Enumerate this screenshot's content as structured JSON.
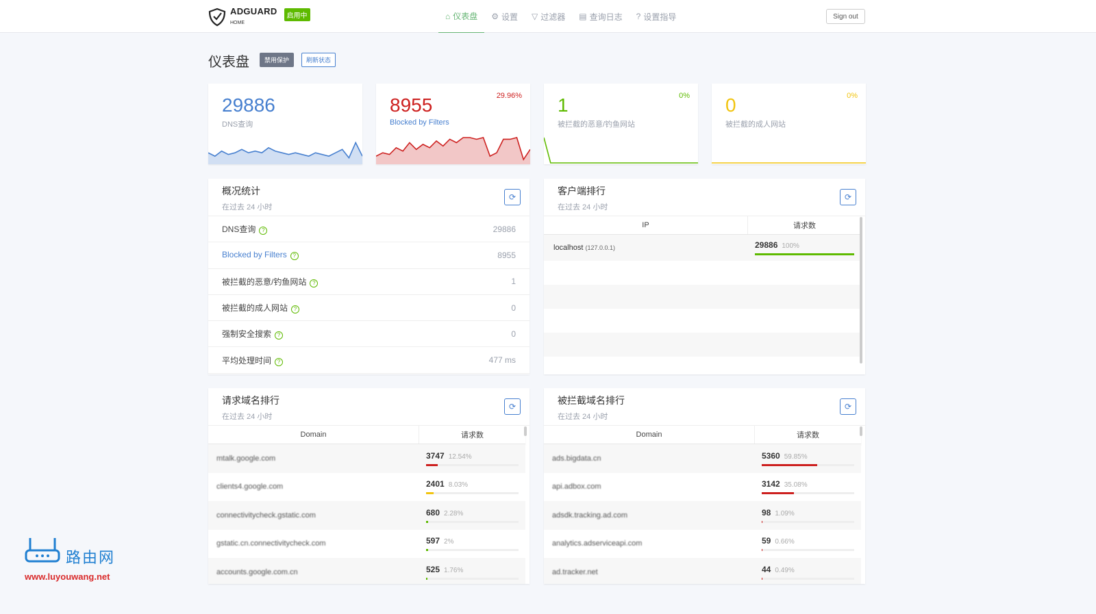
{
  "header": {
    "brand": "ADGUARD",
    "brand_sub": "HOME",
    "status_badge": "启用中",
    "sign_out": "Sign out",
    "nav": [
      {
        "label": "仪表盘",
        "icon": "home-icon",
        "active": true
      },
      {
        "label": "设置",
        "icon": "gear-icon"
      },
      {
        "label": "过滤器",
        "icon": "filter-icon"
      },
      {
        "label": "查询日志",
        "icon": "document-icon"
      },
      {
        "label": "设置指导",
        "icon": "help-icon"
      }
    ]
  },
  "page": {
    "title": "仪表盘",
    "disable_btn": "禁用保护",
    "refresh_btn": "刷新状态"
  },
  "stats": [
    {
      "value": "29886",
      "label": "DNS查询",
      "percent": "",
      "color": "#467fcf",
      "spark": [
        6,
        4,
        7,
        5,
        6,
        8,
        6,
        7,
        6,
        9,
        7,
        6,
        5,
        6,
        5,
        4,
        6,
        5,
        4,
        6,
        8,
        3,
        12,
        4
      ]
    },
    {
      "value": "8955",
      "label": "Blocked by Filters",
      "percent": "29.96%",
      "color": "#cd201f",
      "spark": [
        4,
        6,
        5,
        9,
        7,
        12,
        8,
        11,
        9,
        13,
        10,
        14,
        12,
        15,
        15,
        14,
        15,
        4,
        6,
        14,
        14,
        15,
        2,
        8
      ]
    },
    {
      "value": "1",
      "label": "被拦截的恶意/钓鱼网站",
      "percent": "0%",
      "color": "#5eba00",
      "spark": [
        15,
        0,
        0,
        0,
        0,
        0,
        0,
        0,
        0,
        0,
        0,
        0,
        0,
        0,
        0,
        0,
        0,
        0,
        0,
        0,
        0,
        0,
        0,
        0
      ]
    },
    {
      "value": "0",
      "label": "被拦截的成人网站",
      "percent": "0%",
      "color": "#f1c40f",
      "spark": [
        0,
        0,
        0,
        0,
        0,
        0,
        0,
        0,
        0,
        0,
        0,
        0,
        0,
        0,
        0,
        0,
        0,
        0,
        0,
        0,
        0,
        0,
        0,
        0
      ]
    }
  ],
  "overview": {
    "title": "概况统计",
    "subtitle": "在过去 24 小时",
    "rows": [
      {
        "label": "DNS查询",
        "value": "29886"
      },
      {
        "label": "Blocked by Filters",
        "value": "8955",
        "link": true
      },
      {
        "label": "被拦截的恶意/钓鱼网站",
        "value": "1"
      },
      {
        "label": "被拦截的成人网站",
        "value": "0"
      },
      {
        "label": "强制安全搜索",
        "value": "0"
      },
      {
        "label": "平均处理时间",
        "value": "477 ms"
      }
    ]
  },
  "clients": {
    "title": "客户端排行",
    "subtitle": "在过去 24 小时",
    "col_ip": "IP",
    "col_count": "请求数",
    "rows": [
      {
        "name": "localhost",
        "ip": "(127.0.0.1)",
        "count": "29886",
        "percent": "100%",
        "fill": 100
      }
    ]
  },
  "top_domains": {
    "title": "请求域名排行",
    "subtitle": "在过去 24 小时",
    "col_domain": "Domain",
    "col_count": "请求数",
    "rows": [
      {
        "domain": "mtalk.google.com",
        "count": "3747",
        "percent": "12.54%",
        "fill": 12.54,
        "color": "#cd201f"
      },
      {
        "domain": "clients4.google.com",
        "count": "2401",
        "percent": "8.03%",
        "fill": 8.03,
        "color": "#f1c40f"
      },
      {
        "domain": "connectivitycheck.gstatic.com",
        "count": "680",
        "percent": "2.28%",
        "fill": 2.28,
        "color": "#5eba00"
      },
      {
        "domain": "gstatic.cn.connectivitycheck.com",
        "count": "597",
        "percent": "2%",
        "fill": 2,
        "color": "#5eba00"
      },
      {
        "domain": "accounts.google.com.cn",
        "count": "525",
        "percent": "1.76%",
        "fill": 1.76,
        "color": "#5eba00"
      }
    ]
  },
  "blocked_domains": {
    "title": "被拦截域名排行",
    "subtitle": "在过去 24 小时",
    "col_domain": "Domain",
    "col_count": "请求数",
    "rows": [
      {
        "domain": "ads.bigdata.cn",
        "count": "5360",
        "percent": "59.85%",
        "fill": 59.85,
        "color": "#cd201f"
      },
      {
        "domain": "api.adbox.com",
        "count": "3142",
        "percent": "35.08%",
        "fill": 35.08,
        "color": "#cd201f"
      },
      {
        "domain": "adsdk.tracking.ad.com",
        "count": "98",
        "percent": "1.09%",
        "fill": 1.09,
        "color": "#cd201f"
      },
      {
        "domain": "analytics.adserviceapi.com",
        "count": "59",
        "percent": "0.66%",
        "fill": 0.66,
        "color": "#cd201f"
      },
      {
        "domain": "ad.tracker.net",
        "count": "44",
        "percent": "0.49%",
        "fill": 0.49,
        "color": "#cd201f"
      }
    ]
  },
  "watermark": {
    "name": "路由网",
    "url": "www.luyouwang.net"
  }
}
